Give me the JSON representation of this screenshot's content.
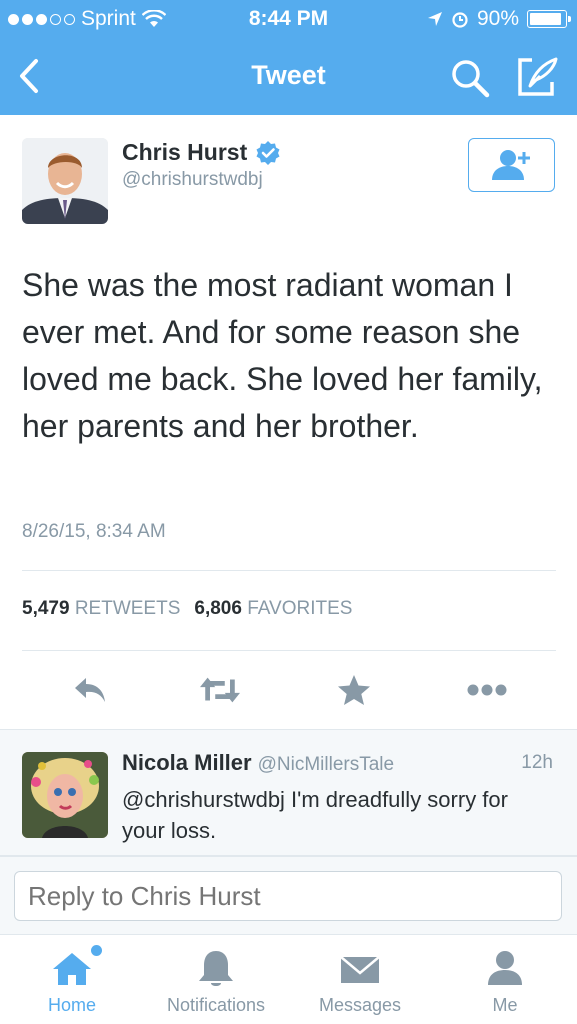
{
  "status_bar": {
    "carrier": "Sprint",
    "time": "8:44 PM",
    "battery": "90%",
    "battery_level": 0.9
  },
  "nav": {
    "title": "Tweet"
  },
  "tweet": {
    "author_name": "Chris Hurst",
    "author_handle": "@chrishurstwdbj",
    "text": "She was the most radiant woman I ever met. And for some reason she loved me back. She loved her family, her parents and her brother.",
    "timestamp": "8/26/15, 8:34 AM",
    "retweets_count": "5,479",
    "retweets_label": "RETWEETS",
    "favorites_count": "6,806",
    "favorites_label": "FAVORITES"
  },
  "reply": {
    "name": "Nicola Miller",
    "handle": "@NicMillersTale",
    "time": "12h",
    "text": "@chrishurstwdbj I'm dreadfully sorry for your loss."
  },
  "compose": {
    "placeholder": "Reply to Chris Hurst"
  },
  "tabs": [
    {
      "label": "Home",
      "icon": "home-icon"
    },
    {
      "label": "Notifications",
      "icon": "bell-icon"
    },
    {
      "label": "Messages",
      "icon": "envelope-icon"
    },
    {
      "label": "Me",
      "icon": "person-icon"
    }
  ],
  "colors": {
    "brand": "#55acee",
    "muted": "#8899a6",
    "text": "#292f33"
  }
}
